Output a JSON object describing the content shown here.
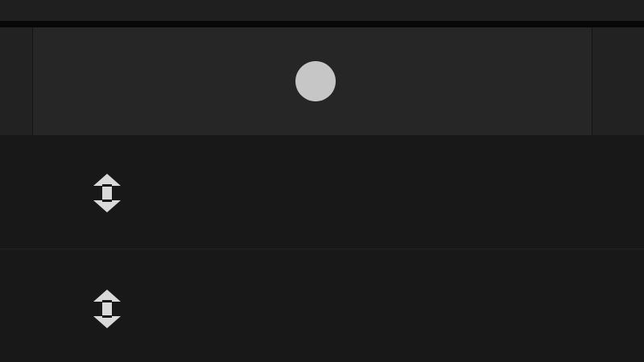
{
  "colors": {
    "background": "#181818",
    "top_bar": "#1f1f1f",
    "header_row": "#262626",
    "status_dot": "#c6c6c6",
    "icon": "#d9d9d9"
  },
  "header": {
    "status_indicator": "status-dot"
  },
  "rows": [
    {
      "icon": "resize-vertical-icon"
    },
    {
      "icon": "resize-vertical-icon"
    }
  ]
}
